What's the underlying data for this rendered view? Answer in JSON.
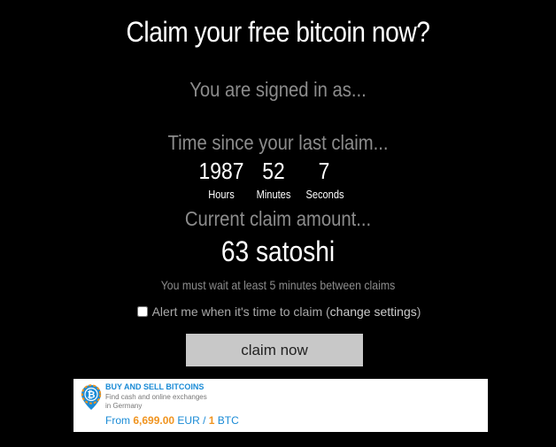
{
  "page": {
    "title": "Claim your free bitcoin now?",
    "signed_in": "You are signed in as...",
    "time_since_label": "Time since your last claim...",
    "timer": {
      "hours_value": "1987",
      "minutes_value": "52",
      "seconds_value": "7",
      "hours_label": "Hours",
      "minutes_label": "Minutes",
      "seconds_label": "Seconds"
    },
    "claim_amount_label": "Current claim amount...",
    "claim_amount": "63 satoshi",
    "wait_note": "You must wait at least 5 minutes between claims",
    "alert": {
      "checked": false,
      "text_prefix": "Alert me when it's time to claim (",
      "link_text": "change settings",
      "text_suffix": ")"
    },
    "claim_button": "claim now"
  },
  "ad": {
    "icon": "bitcoin-location-pin-icon",
    "title": "BUY AND SELL BITCOINS",
    "desc_line1": "Find cash and online exchanges",
    "desc_line2": "in Germany",
    "price_prefix": "From ",
    "price_value": "6,699.00",
    "price_currency": " EUR / ",
    "price_btc_amount": "1",
    "price_btc_unit": " BTC",
    "colors": {
      "accent_blue": "#1a8bd6",
      "accent_orange": "#f0941f"
    }
  },
  "colors": {
    "background": "#000000",
    "muted_text": "#8c8c8c",
    "button_bg": "#c8c8c8"
  }
}
